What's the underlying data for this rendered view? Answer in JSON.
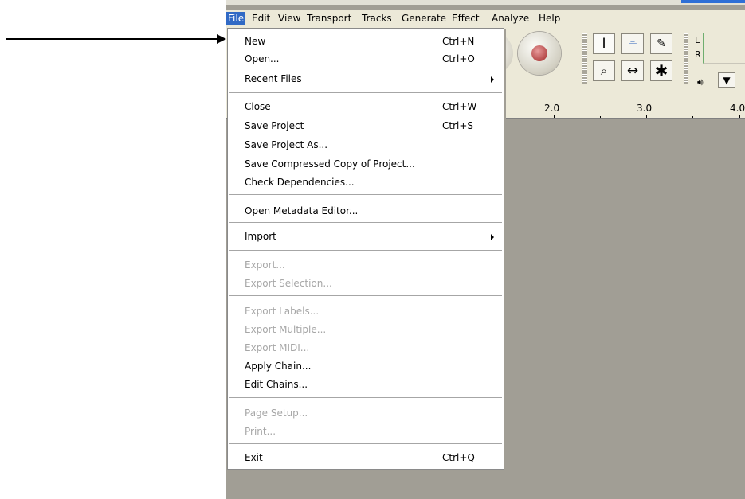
{
  "menubar": {
    "items": [
      "File",
      "Edit",
      "View",
      "Transport",
      "Tracks",
      "Generate",
      "Effect",
      "Analyze",
      "Help"
    ]
  },
  "ruler": {
    "labels": [
      "2.0",
      "3.0",
      "4.0"
    ]
  },
  "meters": {
    "left": "L",
    "right": "R"
  },
  "toolbar_icons": [
    "record-icon",
    "selection-tool-icon",
    "envelope-tool-icon",
    "draw-tool-icon",
    "zoom-tool-icon",
    "time-shift-tool-icon",
    "multi-tool-icon",
    "speaker-icon"
  ],
  "file_menu": {
    "new": {
      "label": "New",
      "shortcut": "Ctrl+N"
    },
    "open": {
      "label": "Open...",
      "shortcut": "Ctrl+O"
    },
    "recent": {
      "label": "Recent Files"
    },
    "close": {
      "label": "Close",
      "shortcut": "Ctrl+W"
    },
    "save": {
      "label": "Save Project",
      "shortcut": "Ctrl+S"
    },
    "save_as": {
      "label": "Save Project As..."
    },
    "save_compressed": {
      "label": "Save Compressed Copy of Project..."
    },
    "check_dependencies": {
      "label": "Check Dependencies..."
    },
    "metadata": {
      "label": "Open Metadata Editor..."
    },
    "import": {
      "label": "Import"
    },
    "export": {
      "label": "Export..."
    },
    "export_selection": {
      "label": "Export Selection..."
    },
    "export_labels": {
      "label": "Export Labels..."
    },
    "export_multiple": {
      "label": "Export Multiple..."
    },
    "export_midi": {
      "label": "Export MIDI..."
    },
    "apply_chain": {
      "label": "Apply Chain..."
    },
    "edit_chains": {
      "label": "Edit Chains..."
    },
    "page_setup": {
      "label": "Page Setup..."
    },
    "print": {
      "label": "Print..."
    },
    "exit": {
      "label": "Exit",
      "shortcut": "Ctrl+Q"
    }
  },
  "colors": {
    "menu_highlight": "#316ac5",
    "workspace": "#a19e95",
    "chrome": "#ece9d8",
    "disabled_text": "#a6a6a6"
  }
}
